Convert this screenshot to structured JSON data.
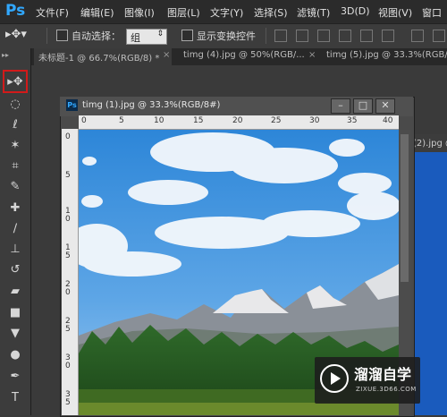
{
  "app": {
    "logo": "Ps"
  },
  "menu": [
    "文件(F)",
    "编辑(E)",
    "图像(I)",
    "图层(L)",
    "文字(Y)",
    "选择(S)",
    "滤镜(T)",
    "3D(D)",
    "视图(V)",
    "窗口"
  ],
  "options_bar": {
    "auto_select_label": "自动选择：",
    "auto_select_value": "组",
    "show_transform_label": "显示变换控件"
  },
  "tabs": [
    {
      "label": "未标题-1 @ 66.7%(RGB/8) *",
      "close": "×"
    },
    {
      "label": "timg (4).jpg @ 50%(RGB/...",
      "close": "×"
    },
    {
      "label": "timg (5).jpg @ 33.3%(RGB/...",
      "close": "×"
    }
  ],
  "document": {
    "title": "timg (1).jpg @ 33.3%(RGB/8#)",
    "ruler_h": [
      "0",
      "5",
      "10",
      "15",
      "20",
      "25",
      "30",
      "35",
      "40"
    ],
    "ruler_v": [
      "0",
      "5",
      "1\n0",
      "1\n5",
      "2\n0",
      "2\n5",
      "3\n0",
      "3\n5"
    ]
  },
  "background_doc_title": "(2).jpg @",
  "watermark": {
    "brand": "溜溜自学",
    "url": "ZIXUE.3D66.COM"
  },
  "tools": [
    "move-tool",
    "marquee-tool",
    "lasso-tool",
    "magic-wand-tool",
    "crop-tool",
    "eyedropper-tool",
    "healing-brush-tool",
    "brush-tool",
    "clone-stamp-tool",
    "history-brush-tool",
    "eraser-tool",
    "gradient-tool",
    "blur-tool",
    "dodge-tool",
    "pen-tool",
    "type-tool"
  ]
}
